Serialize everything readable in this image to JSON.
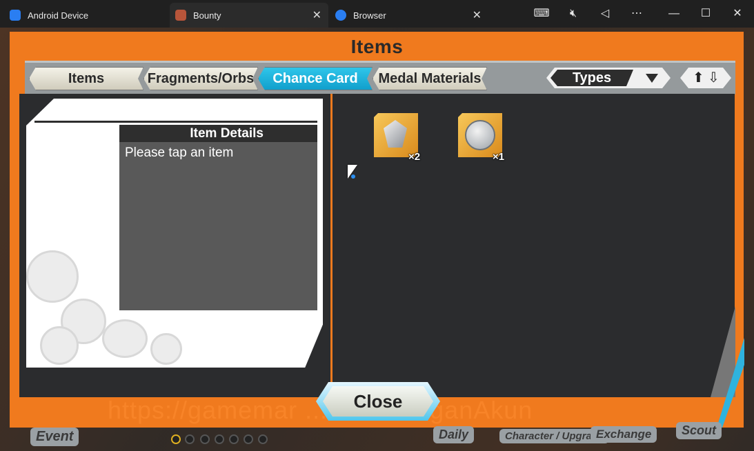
{
  "window": {
    "tabs": [
      {
        "label": "Android Device",
        "icon": "android-device-icon",
        "active": false
      },
      {
        "label": "Bounty",
        "icon": "bounty-game-icon",
        "active": true
      },
      {
        "label": "Browser",
        "icon": "browser-icon",
        "active": false
      }
    ],
    "system_controls": [
      "keyboard-icon",
      "mute-icon",
      "back-icon",
      "more-icon",
      "minimize-icon",
      "maximize-icon",
      "close-window-icon"
    ]
  },
  "game": {
    "title": "Items",
    "category_tabs": [
      {
        "label": "Items",
        "active": false
      },
      {
        "label": "Fragments/Orbs",
        "active": false
      },
      {
        "label": "Chance Card",
        "active": true
      },
      {
        "label": "Medal Materials",
        "active": false
      }
    ],
    "filter": {
      "label": "Types"
    },
    "item_details": {
      "header": "Item Details",
      "message": "Please tap an item"
    },
    "items": [
      {
        "icon": "crystal-icon",
        "quantity": "×2"
      },
      {
        "icon": "bounty-coin-icon",
        "quantity": "×1"
      }
    ],
    "close_label": "Close",
    "watermark": "https://gamemar    ....me/JuraganAkun",
    "bottom_nav": [
      "Event",
      "Daily",
      "Character / Upgrade",
      "Exchange",
      "Scout"
    ],
    "colors": {
      "frame": "#f07a1e",
      "active_tab": "#19b0dc"
    }
  }
}
